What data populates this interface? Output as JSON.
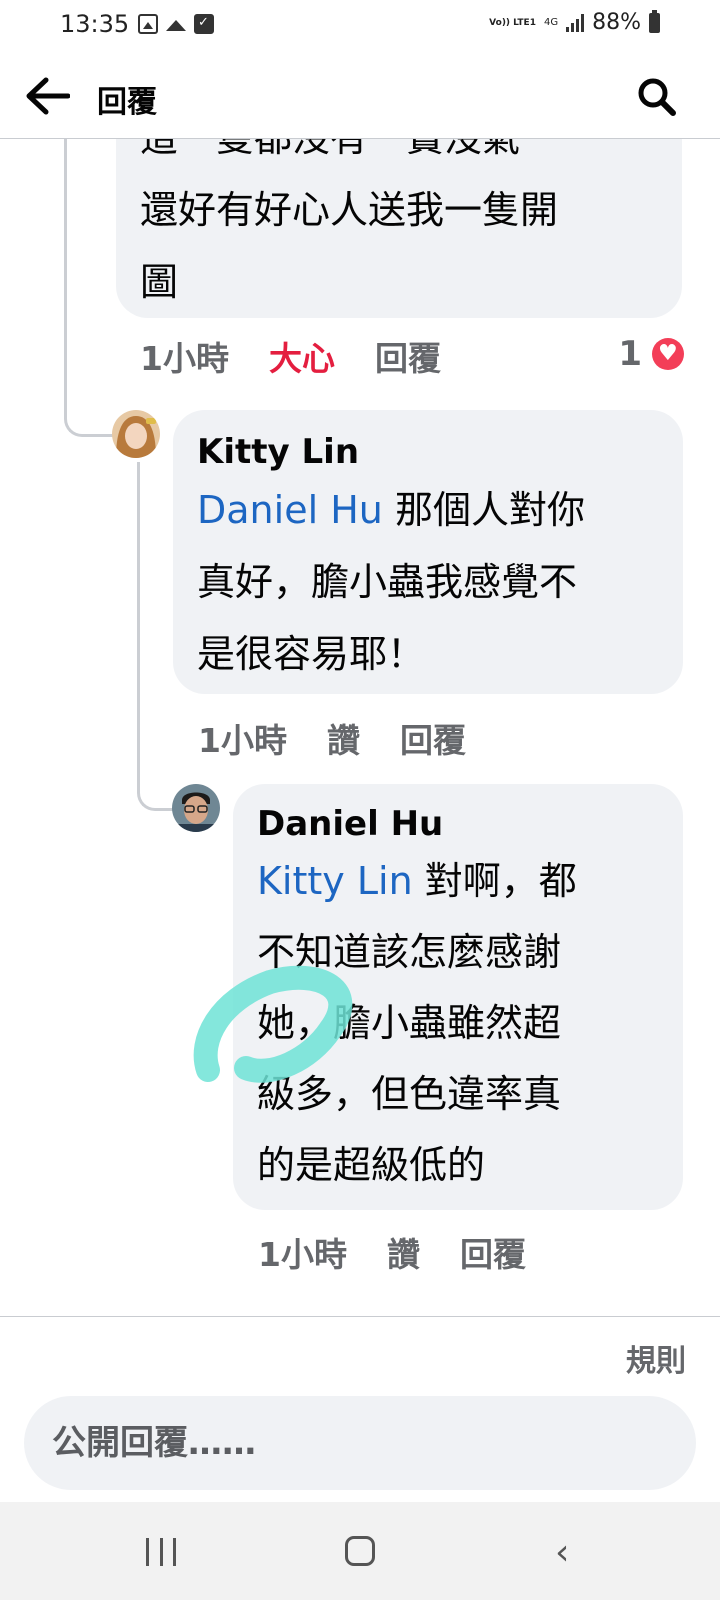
{
  "status_bar": {
    "time": "13:35",
    "volte": "Vo)) LTE1",
    "network": "4G",
    "battery": "88%"
  },
  "header": {
    "title": "回覆"
  },
  "comments": [
    {
      "body_partial": "這一隻都沒有一寶沒氣",
      "body": "還好有好心人送我一隻開圖",
      "body_lines": [
        "還好有好心人送我一隻開",
        "圖"
      ],
      "time": "1小時",
      "reaction_label": "大心",
      "reply_label": "回覆",
      "reaction_count": "1"
    },
    {
      "author": "Kitty Lin",
      "mention": "Daniel Hu",
      "body_lines": [
        "那個人對你",
        "真好，膽小蟲我感覺不",
        "是很容易耶！"
      ],
      "time": "1小時",
      "like_label": "讚",
      "reply_label": "回覆"
    },
    {
      "author": "Daniel Hu",
      "mention": "Kitty Lin",
      "body_lines": [
        "對啊，都",
        "不知道該怎麼感謝",
        "她，膽小蟲雖然超",
        "級多，但色違率真",
        "的是超級低的"
      ],
      "time": "1小時",
      "like_label": "讚",
      "reply_label": "回覆"
    }
  ],
  "footer": {
    "rules_label": "規則",
    "reply_placeholder": "公開回覆……"
  },
  "colors": {
    "mention": "#1d66c2",
    "love": "#e41e3f",
    "bubble": "#f0f2f5",
    "annotation": "#6fe3d6"
  }
}
